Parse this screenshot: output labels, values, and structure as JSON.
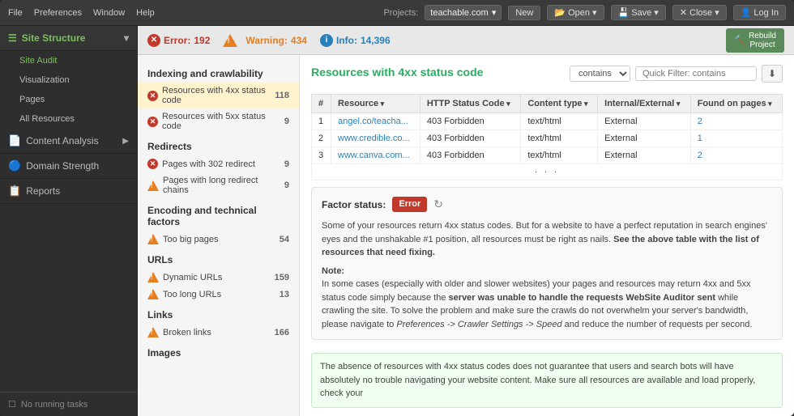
{
  "titlebar": {
    "menu": [
      "File",
      "Preferences",
      "Window",
      "Help"
    ],
    "project_label": "Projects:",
    "project_name": "teachable.com",
    "buttons": [
      "New",
      "Open",
      "Save",
      "Close",
      "Log In"
    ]
  },
  "statusbar": {
    "error_label": "Error:",
    "error_count": "192",
    "warning_label": "Warning:",
    "warning_count": "434",
    "info_label": "Info:",
    "info_count": "14,396",
    "rebuild_label": "Rebuild\nProject"
  },
  "sidebar": {
    "site_structure_label": "Site Structure",
    "items": [
      {
        "label": "Site Audit",
        "active": true
      },
      {
        "label": "Visualization"
      },
      {
        "label": "Pages"
      },
      {
        "label": "All Resources"
      }
    ],
    "content_analysis_label": "Content Analysis",
    "domain_strength_label": "Domain Strength",
    "reports_label": "Reports",
    "no_running_tasks": "No running tasks"
  },
  "left_panel": {
    "sections": [
      {
        "title": "Indexing and crawlability",
        "items": [
          {
            "type": "error",
            "label": "Resources with 4xx status code",
            "count": 118,
            "selected": true
          },
          {
            "type": "error",
            "label": "Resources with 5xx status code",
            "count": 9
          }
        ]
      },
      {
        "title": "Redirects",
        "items": [
          {
            "type": "error",
            "label": "Pages with 302 redirect",
            "count": 9
          },
          {
            "type": "warning",
            "label": "Pages with long redirect chains",
            "count": 9
          }
        ]
      },
      {
        "title": "Encoding and technical factors",
        "items": [
          {
            "type": "warning",
            "label": "Too big pages",
            "count": 54
          }
        ]
      },
      {
        "title": "URLs",
        "items": [
          {
            "type": "warning",
            "label": "Dynamic URLs",
            "count": 159
          },
          {
            "type": "warning",
            "label": "Too long URLs",
            "count": 13
          }
        ]
      },
      {
        "title": "Links",
        "items": [
          {
            "type": "warning",
            "label": "Broken links",
            "count": 166
          }
        ]
      },
      {
        "title": "Images",
        "items": []
      }
    ]
  },
  "right_panel": {
    "title": "Resources with 4xx status code",
    "filter_placeholder": "Quick Filter: contains",
    "filter_contains": "contains",
    "export_tooltip": "Export",
    "columns": [
      "#",
      "Resource",
      "HTTP Status Code",
      "Content type",
      "Internal/External",
      "Found on pages"
    ],
    "rows": [
      {
        "num": 1,
        "resource": "angel.co/teaсha...",
        "status": "403 Forbidden",
        "content_type": "text/html",
        "internal_external": "External",
        "found_on": 2
      },
      {
        "num": 2,
        "resource": "www.credible.co...",
        "status": "403 Forbidden",
        "content_type": "text/html",
        "internal_external": "External",
        "found_on": 1
      },
      {
        "num": 3,
        "resource": "www.canva.com...",
        "status": "403 Forbidden",
        "content_type": "text/html",
        "internal_external": "External",
        "found_on": 2
      }
    ],
    "factor_status": {
      "label": "Factor status:",
      "status": "Error",
      "description": "Some of your resources return 4xx status codes. But for a website to have a perfect reputation in search engines' eyes and the unshakable #1 position, all resources must be right as nails.",
      "bold_part": "See the above table with the list of resources that need fixing.",
      "note_label": "Note:",
      "note_text": "In some cases (especially with older and slower websites) your pages and resources may return 4xx and 5xx status code simply because the",
      "note_bold": "server was unable to handle the requests WebSite Auditor sent",
      "note_text2": "while crawling the site. To solve the problem and make sure the crawls do not overwhelm your server's bandwidth, please navigate to",
      "note_italic": "Preferences -> Crawler Settings -> Speed",
      "note_text3": "and reduce the number of requests per second.",
      "highlight_text": "The absence of resources with 4xx status codes does not guarantee that users and search bots will have absolutely no trouble navigating your website content. Make sure all resources are available and load properly, check your"
    }
  }
}
